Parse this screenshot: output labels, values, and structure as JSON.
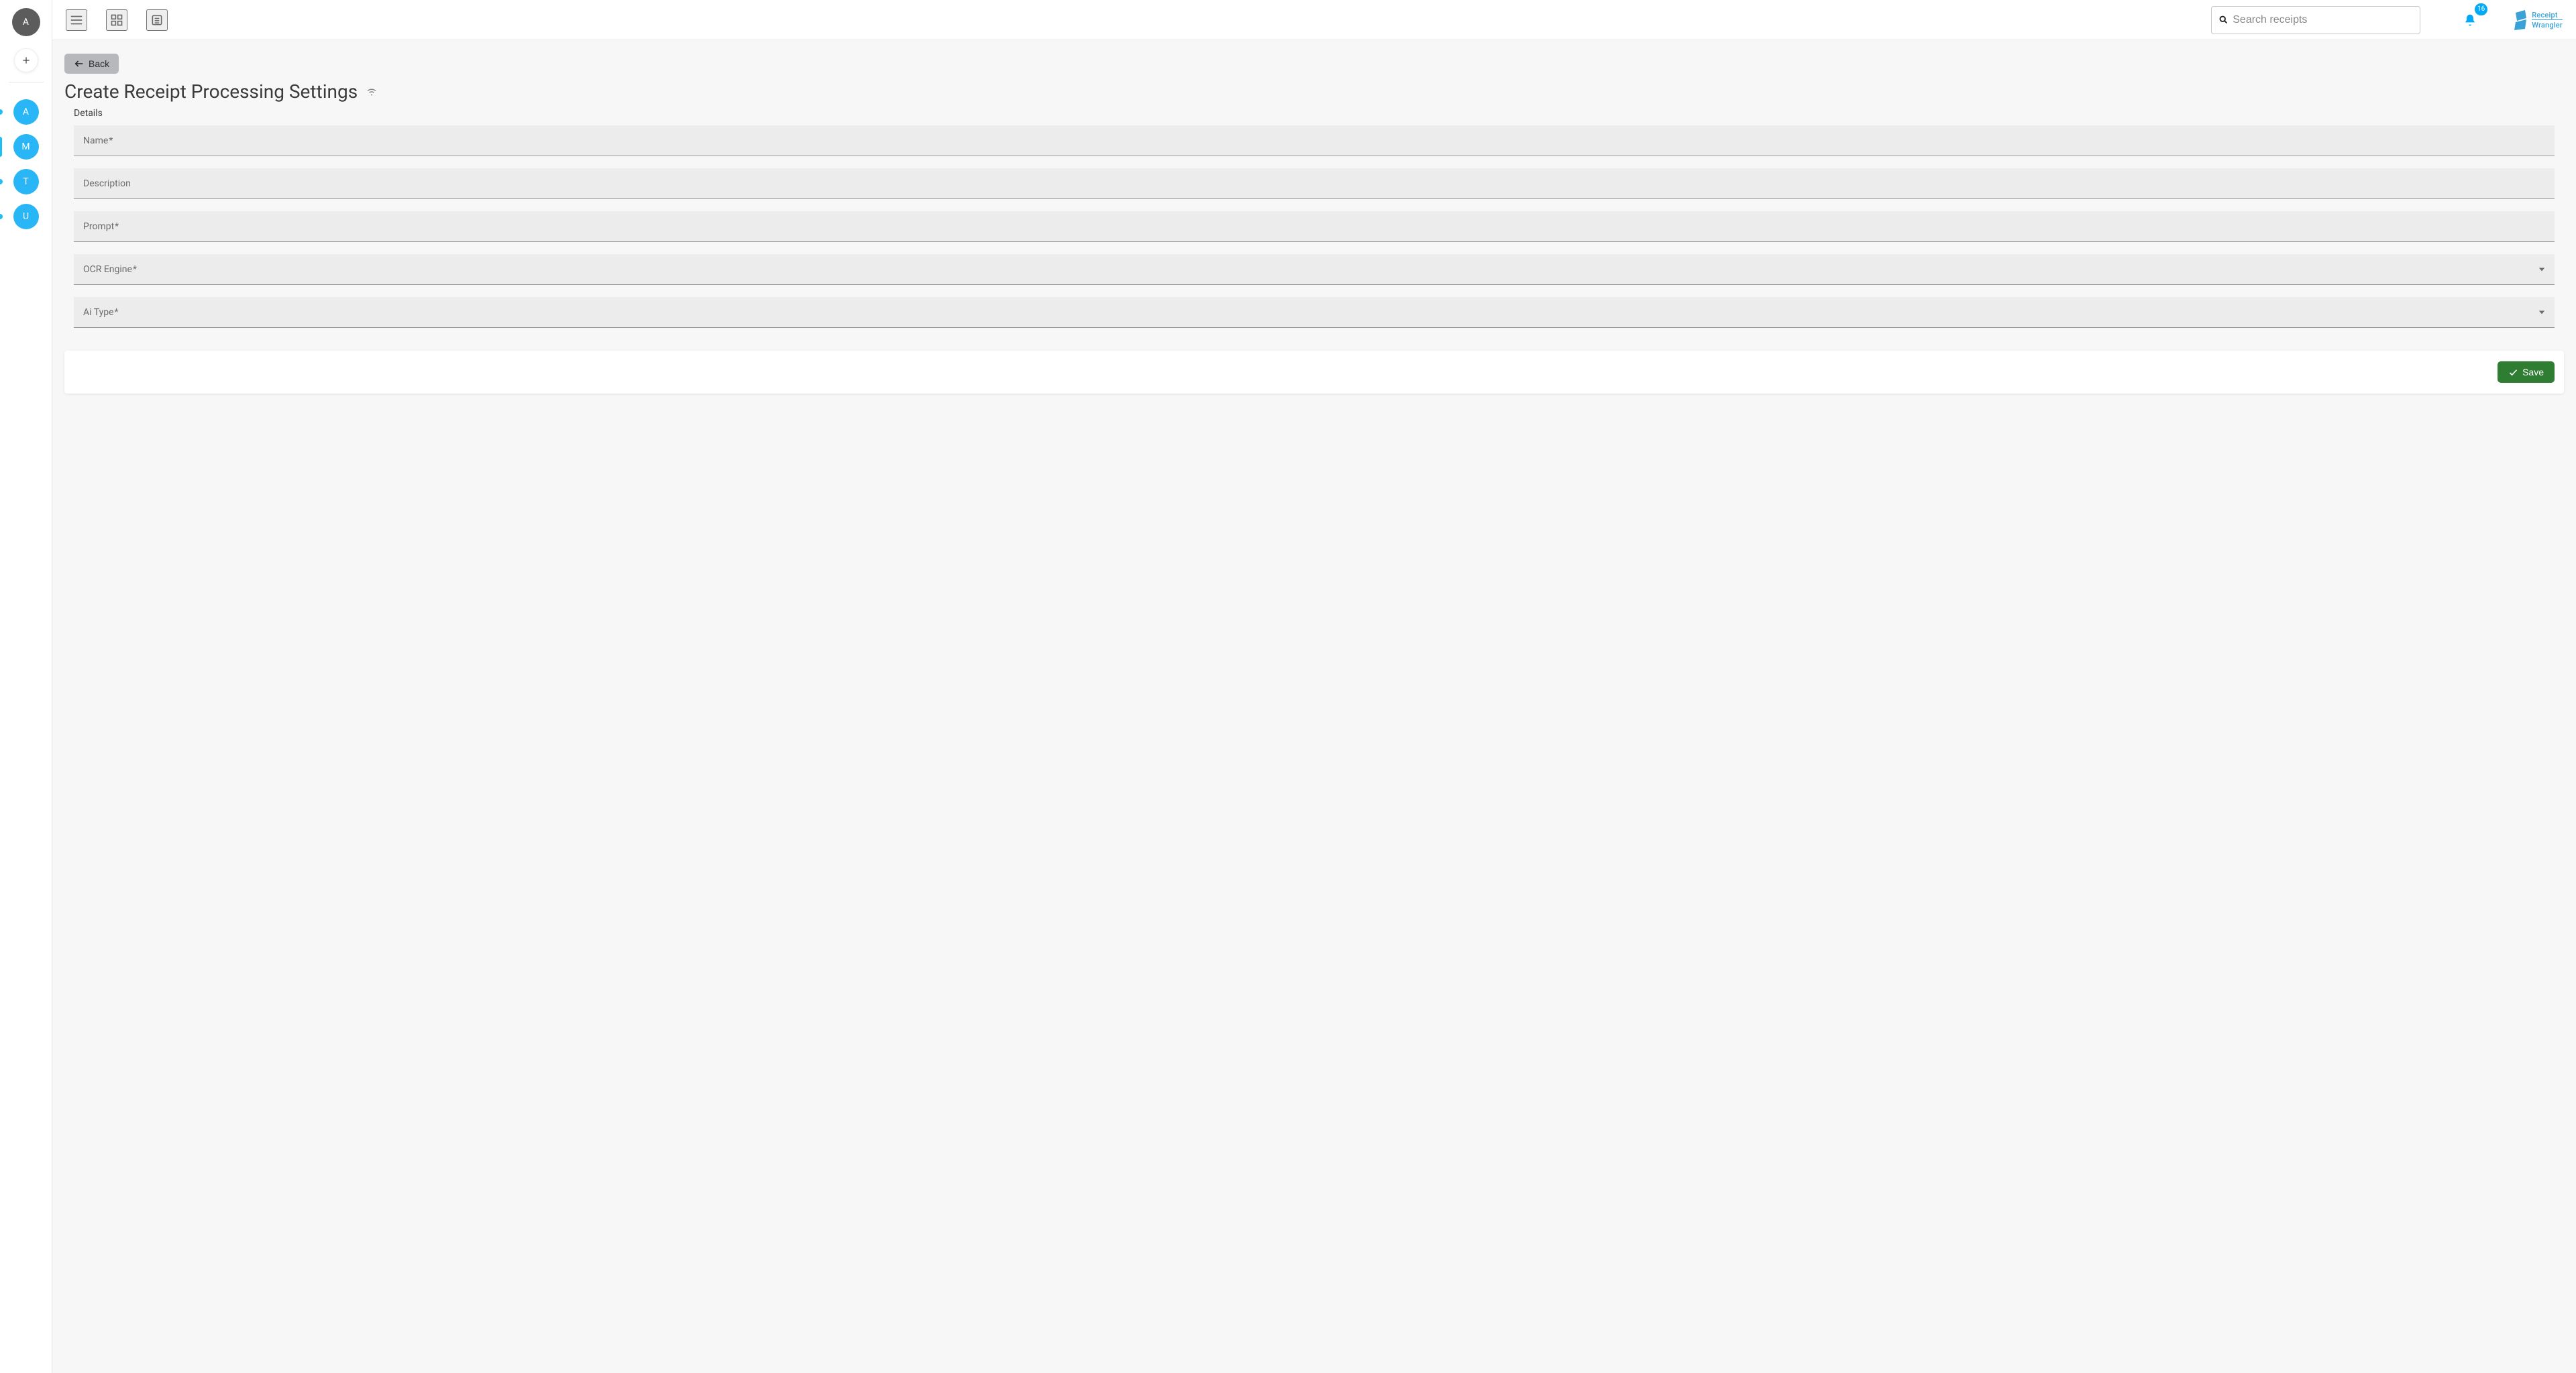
{
  "rail": {
    "top_avatar_letter": "A",
    "items": [
      {
        "letter": "A",
        "active": false
      },
      {
        "letter": "M",
        "active": true
      },
      {
        "letter": "T",
        "active": false
      },
      {
        "letter": "U",
        "active": false
      }
    ]
  },
  "topbar": {
    "search_placeholder": "Search receipts",
    "notification_count": "16",
    "brand_line1": "Receipt",
    "brand_line2": "Wrangler"
  },
  "page": {
    "back_label": "Back",
    "title": "Create Receipt Processing Settings",
    "section_label": "Details",
    "fields": {
      "name_label": "Name",
      "description_label": "Description",
      "prompt_label": "Prompt",
      "ocr_label": "OCR Engine",
      "ai_label": "Ai Type"
    },
    "save_label": "Save"
  }
}
